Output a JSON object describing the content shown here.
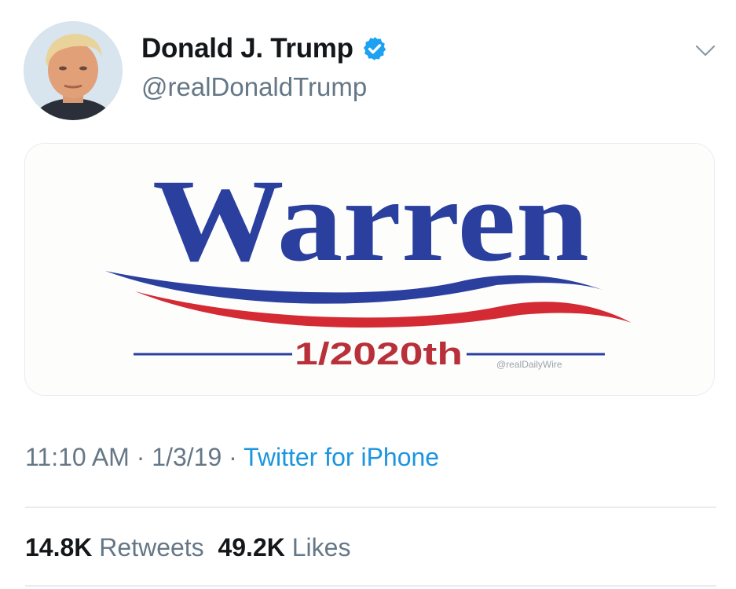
{
  "tweet": {
    "author": {
      "name": "Donald J. Trump",
      "handle": "@realDonaldTrump",
      "verified": true,
      "avatar_icon": "profile-photo"
    },
    "menu_icon": "chevron-down-icon",
    "media": {
      "headline": "Warren",
      "tagline": "1/2020th",
      "watermark": "@realDailyWire",
      "colors": {
        "blue": "#2a3f9e",
        "red": "#d42a34",
        "background": "#fdfdfc"
      }
    },
    "meta": {
      "time": "11:10 AM",
      "separator": "·",
      "date": "1/3/19",
      "source": "Twitter for iPhone"
    },
    "stats": {
      "retweets_count": "14.8K",
      "retweets_label": "Retweets",
      "likes_count": "49.2K",
      "likes_label": "Likes"
    }
  },
  "colors": {
    "text_primary": "#14171a",
    "text_secondary": "#657786",
    "link": "#1b95e0",
    "verified": "#1da1f2",
    "divider": "#e6ecf0"
  }
}
